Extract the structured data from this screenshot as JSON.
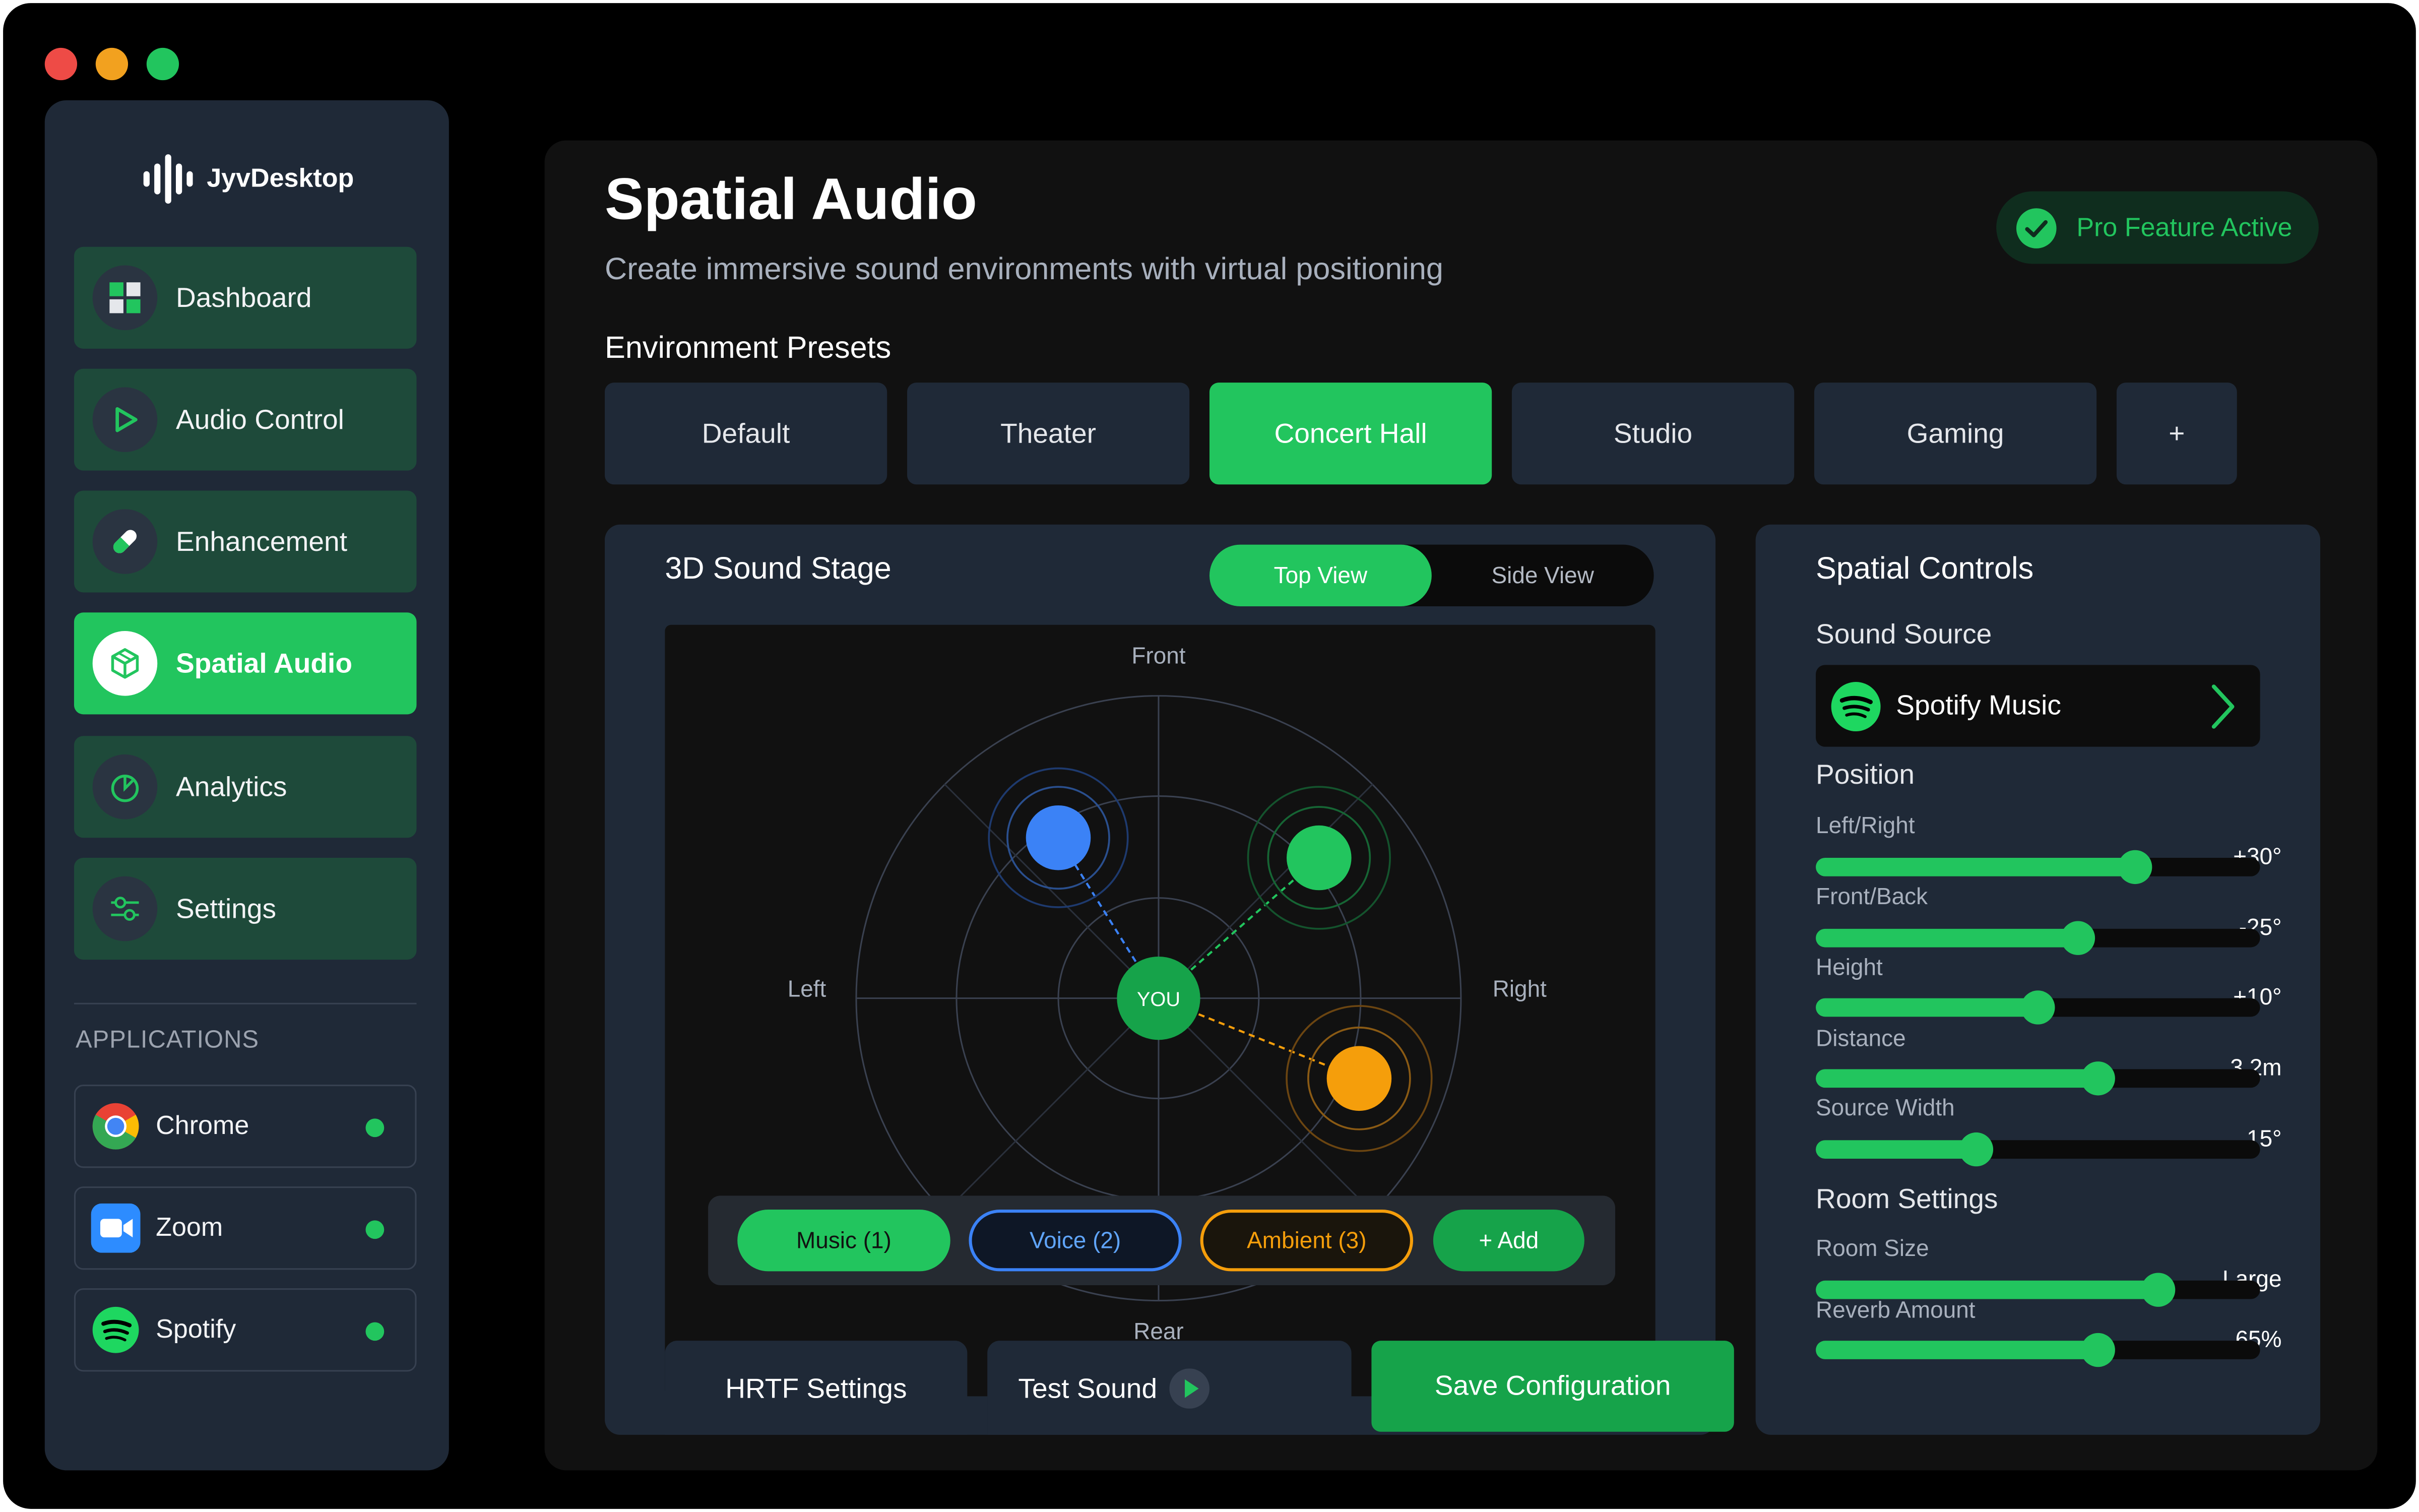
{
  "app": {
    "name": "JyvDesktop",
    "window_controls": [
      "close",
      "minimize",
      "maximize"
    ]
  },
  "sidebar": {
    "items": [
      {
        "label": "Dashboard",
        "icon": "dashboard-icon",
        "active": false
      },
      {
        "label": "Audio Control",
        "icon": "play-icon",
        "active": false
      },
      {
        "label": "Enhancement",
        "icon": "pill-icon",
        "active": false
      },
      {
        "label": "Spatial Audio",
        "icon": "cube-icon",
        "active": true
      },
      {
        "label": "Analytics",
        "icon": "pie-chart-icon",
        "active": false
      },
      {
        "label": "Settings",
        "icon": "sliders-icon",
        "active": false
      }
    ],
    "applications_title": "APPLICATIONS",
    "applications": [
      {
        "label": "Chrome",
        "icon": "chrome-icon",
        "status": "active"
      },
      {
        "label": "Zoom",
        "icon": "zoom-icon",
        "status": "active"
      },
      {
        "label": "Spotify",
        "icon": "spotify-icon",
        "status": "active"
      }
    ]
  },
  "header": {
    "title": "Spatial Audio",
    "subtitle": "Create immersive sound environments with virtual positioning",
    "badge": "Pro Feature Active"
  },
  "presets": {
    "label": "Environment Presets",
    "items": [
      "Default",
      "Theater",
      "Concert Hall",
      "Studio",
      "Gaming",
      "+"
    ],
    "selected": "Concert Hall"
  },
  "stage": {
    "title": "3D Sound Stage",
    "views": [
      "Top View",
      "Side View"
    ],
    "selected_view": "Top View",
    "directions": {
      "front": "Front",
      "left": "Left",
      "right": "Right",
      "rear": "Rear"
    },
    "listener_label": "YOU",
    "sources": [
      {
        "label": "Music (1)",
        "color": "#22c55e"
      },
      {
        "label": "Voice (2)",
        "color": "#3b82f6"
      },
      {
        "label": "Ambient (3)",
        "color": "#f59e0b"
      }
    ],
    "add_label": "+ Add"
  },
  "bottom_tabs": {
    "hrtf": "HRTF Settings",
    "test": "Test Sound",
    "save": "Save Configuration"
  },
  "controls": {
    "title": "Spatial Controls",
    "sound_source_label": "Sound Source",
    "sound_source": "Spotify Music",
    "position_label": "Position",
    "position_sliders": [
      {
        "label": "Left/Right",
        "value": "+30°",
        "level": 0.72
      },
      {
        "label": "Front/Back",
        "value": "-25°",
        "level": 0.59
      },
      {
        "label": "Height",
        "value": "+10°",
        "level": 0.5
      },
      {
        "label": "Distance",
        "value": "3.2m",
        "level": 0.635
      },
      {
        "label": "Source Width",
        "value": "15°",
        "level": 0.36
      }
    ],
    "room_label": "Room Settings",
    "room_sliders": [
      {
        "label": "Room Size",
        "value": "Large",
        "level": 0.77
      },
      {
        "label": "Reverb Amount",
        "value": "65%",
        "level": 0.635
      }
    ]
  },
  "colors": {
    "accent": "#22c55e",
    "voice": "#3b82f6",
    "ambient": "#f59e0b",
    "panel": "#1f2937",
    "background": "#000000"
  }
}
